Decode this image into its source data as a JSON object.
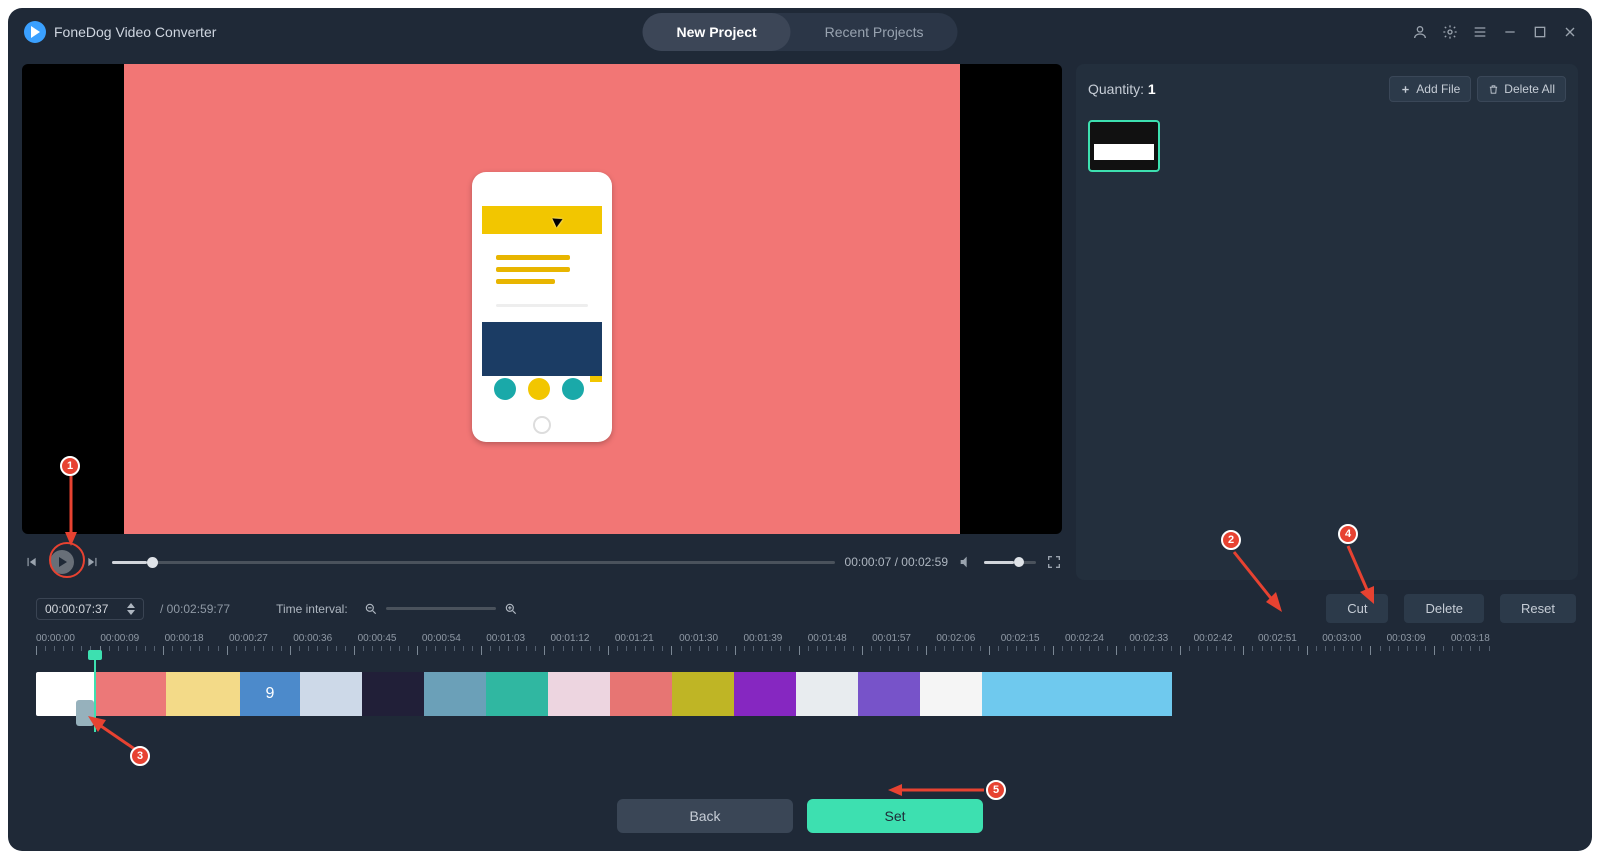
{
  "app": {
    "title": "FoneDog Video Converter"
  },
  "tabs": {
    "new_project": "New Project",
    "recent_projects": "Recent Projects"
  },
  "playback": {
    "current": "00:00:07",
    "total": "00:02:59"
  },
  "timecode": {
    "position": "00:00:07:37",
    "duration_prefix": "/ ",
    "duration": "00:02:59:77",
    "interval_label": "Time interval:"
  },
  "side": {
    "quantity_label": "Quantity: ",
    "quantity_value": "1",
    "add_file": "Add File",
    "delete_all": "Delete All"
  },
  "actions": {
    "cut": "Cut",
    "delete": "Delete",
    "reset": "Reset"
  },
  "bottom": {
    "back": "Back",
    "set": "Set"
  },
  "ruler": [
    "00:00:00",
    "00:00:09",
    "00:00:18",
    "00:00:27",
    "00:00:36",
    "00:00:45",
    "00:00:54",
    "00:01:03",
    "00:01:12",
    "00:01:21",
    "00:01:30",
    "00:01:39",
    "00:01:48",
    "00:01:57",
    "00:02:06",
    "00:02:15",
    "00:02:24",
    "00:02:33",
    "00:02:42",
    "00:02:51",
    "00:03:00",
    "00:03:09",
    "00:03:18"
  ],
  "annotations": {
    "n1": "1",
    "n2": "2",
    "n3": "3",
    "n4": "4",
    "n5": "5"
  },
  "clip4": "9"
}
